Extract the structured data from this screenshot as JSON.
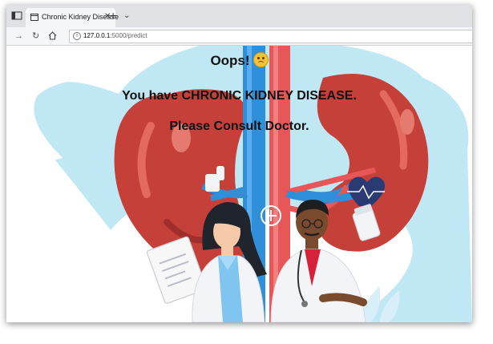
{
  "browser": {
    "tab_title": "Chronic Kidney Disease",
    "tab_close": "✕",
    "new_tab": "+",
    "tabs_dropdown": "⌄",
    "url_domain": "127.0.0.1",
    "url_path": ":5000/predict"
  },
  "page": {
    "line1": "Oops!",
    "line2": "You have CHRONIC KIDNEY DISEASE.",
    "line3": "Please Consult Doctor."
  },
  "colors": {
    "kidney": "#c6403a",
    "background_blob": "#bfe8f4",
    "artery": "#e85757",
    "vein": "#2f8fd8",
    "heart": "#2a3b74"
  },
  "icons": [
    "tab-menu-icon",
    "page-icon",
    "close-icon",
    "plus-icon",
    "chevron-down-icon",
    "forward-icon",
    "refresh-icon",
    "home-icon",
    "info-icon",
    "frown-emoji-icon"
  ]
}
